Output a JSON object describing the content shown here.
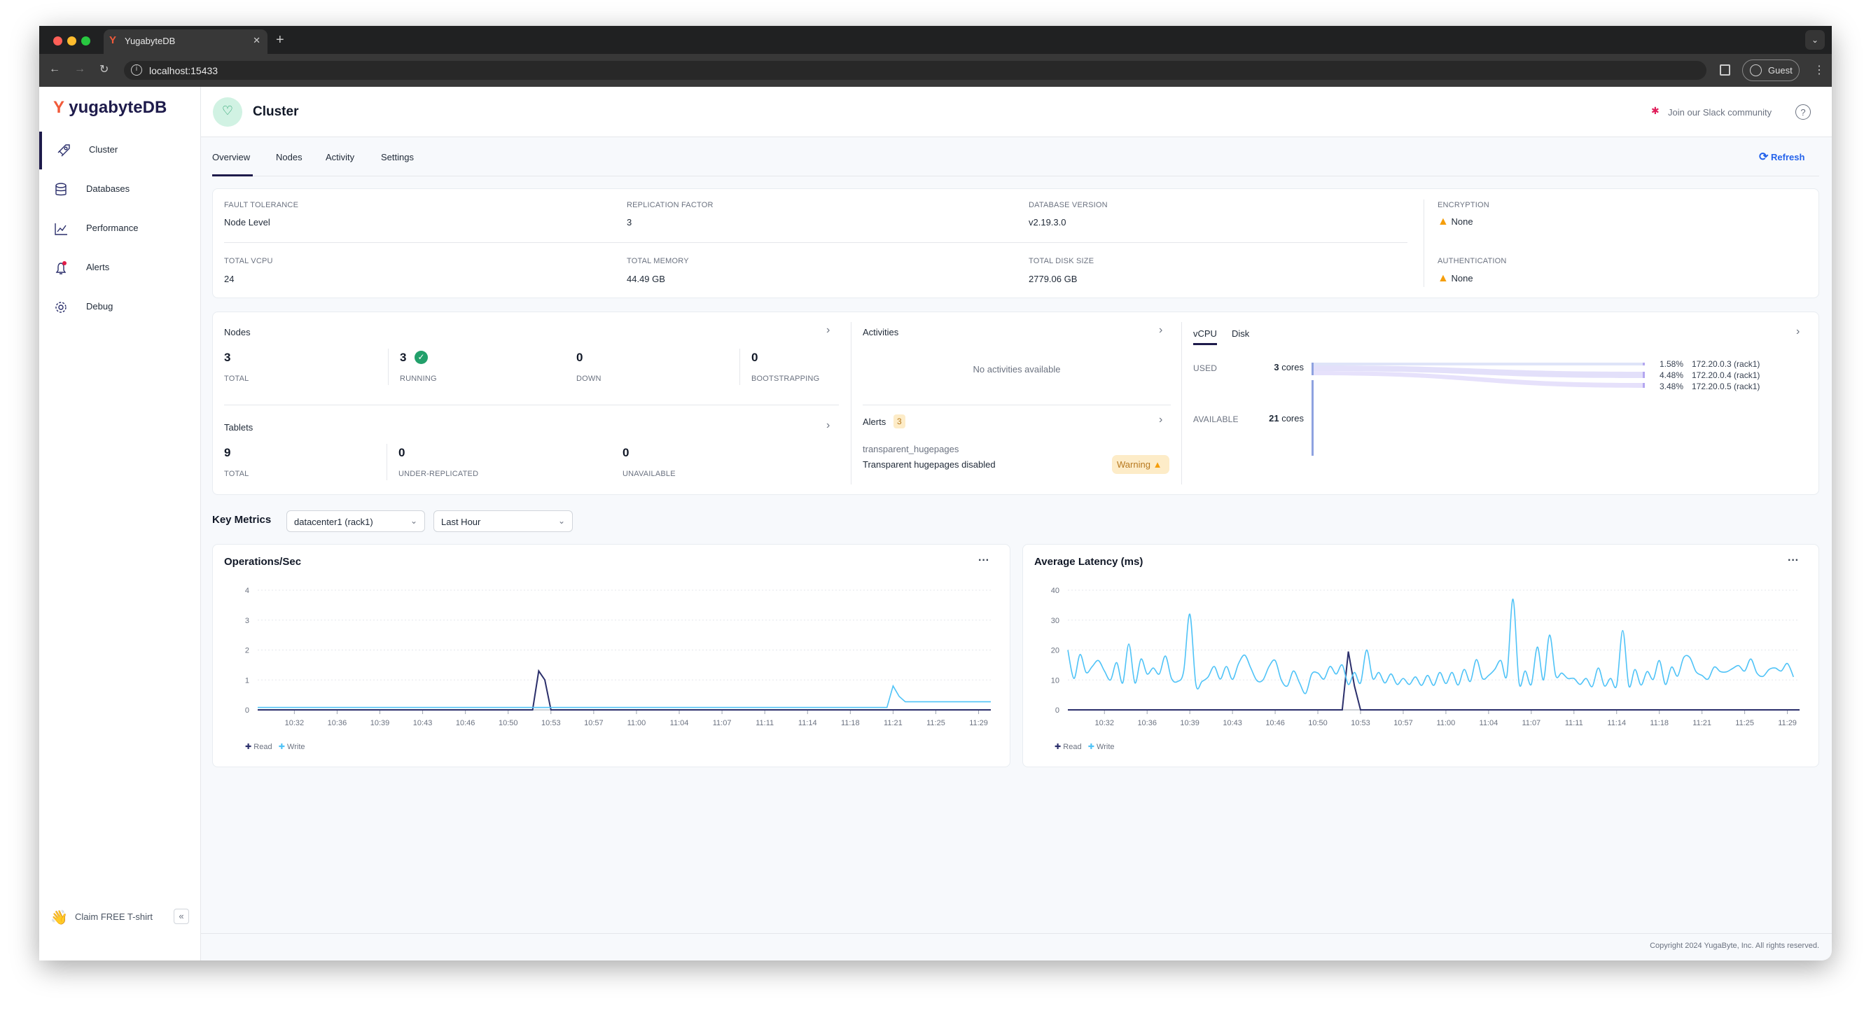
{
  "browser": {
    "tab_title": "YugabyteDB",
    "url": "localhost:15433",
    "profile": "Guest"
  },
  "sidebar": {
    "logo": "yugabyteDB",
    "items": [
      {
        "label": "Cluster",
        "icon": "rocket-icon"
      },
      {
        "label": "Databases",
        "icon": "database-icon"
      },
      {
        "label": "Performance",
        "icon": "chart-line-icon"
      },
      {
        "label": "Alerts",
        "icon": "bell-icon"
      },
      {
        "label": "Debug",
        "icon": "gear-icon"
      }
    ],
    "promo": "Claim FREE T-shirt"
  },
  "header": {
    "title": "Cluster",
    "slack": "Join our Slack community"
  },
  "tabs": [
    "Overview",
    "Nodes",
    "Activity",
    "Settings"
  ],
  "refresh": "Refresh",
  "info": {
    "fault_tolerance": {
      "label": "FAULT TOLERANCE",
      "value": "Node Level"
    },
    "replication_factor": {
      "label": "REPLICATION FACTOR",
      "value": "3"
    },
    "database_version": {
      "label": "DATABASE VERSION",
      "value": "v2.19.3.0"
    },
    "encryption": {
      "label": "ENCRYPTION",
      "value": "None"
    },
    "total_vcpu": {
      "label": "TOTAL VCPU",
      "value": "24"
    },
    "total_memory": {
      "label": "TOTAL MEMORY",
      "value": "44.49 GB"
    },
    "total_disk": {
      "label": "TOTAL DISK SIZE",
      "value": "2779.06 GB"
    },
    "authentication": {
      "label": "AUTHENTICATION",
      "value": "None"
    }
  },
  "nodes": {
    "title": "Nodes",
    "stats": [
      {
        "value": "3",
        "label": "TOTAL"
      },
      {
        "value": "3",
        "label": "RUNNING"
      },
      {
        "value": "0",
        "label": "DOWN"
      },
      {
        "value": "0",
        "label": "BOOTSTRAPPING"
      }
    ]
  },
  "tablets": {
    "title": "Tablets",
    "stats": [
      {
        "value": "9",
        "label": "TOTAL"
      },
      {
        "value": "0",
        "label": "UNDER-REPLICATED"
      },
      {
        "value": "0",
        "label": "UNAVAILABLE"
      }
    ]
  },
  "activities": {
    "title": "Activities",
    "empty": "No activities available"
  },
  "alerts": {
    "title": "Alerts",
    "count": "3",
    "name": "transparent_hugepages",
    "description": "Transparent hugepages disabled",
    "severity": "Warning"
  },
  "usage": {
    "tabs": [
      "vCPU",
      "Disk"
    ],
    "used_label": "USED",
    "used_value": "3",
    "available_label": "AVAILABLE",
    "available_value": "21",
    "unit": "cores",
    "nodes": [
      {
        "pct": "1.58%",
        "name": "172.20.0.3 (rack1)"
      },
      {
        "pct": "4.48%",
        "name": "172.20.0.4 (rack1)"
      },
      {
        "pct": "3.48%",
        "name": "172.20.0.5 (rack1)"
      }
    ]
  },
  "key_metrics": {
    "title": "Key Metrics",
    "region": "datacenter1 (rack1)",
    "range": "Last Hour"
  },
  "colors": {
    "read": "#2b2f6b",
    "write": "#4fc3f7",
    "accent": "#2563eb",
    "warning": "#f59e0b"
  },
  "chart_data": [
    {
      "type": "line",
      "title": "Operations/Sec",
      "ylim": [
        0,
        4
      ],
      "yticks": [
        0,
        1,
        2,
        3,
        4
      ],
      "xlim": [
        "10:29:00",
        "11:29:00"
      ],
      "xticks": [
        "10:32",
        "10:36",
        "10:39",
        "10:43",
        "10:46",
        "10:50",
        "10:53",
        "10:57",
        "11:00",
        "11:04",
        "11:07",
        "11:11",
        "11:14",
        "11:18",
        "11:21",
        "11:25",
        "11:29"
      ],
      "grid": true,
      "legend": "bottom-left",
      "series": [
        {
          "name": "Read",
          "x": [
            "10:29:00",
            "10:51:30",
            "10:52:00",
            "10:52:30",
            "10:53:00",
            "11:29:00"
          ],
          "values": [
            0,
            0,
            1.3,
            1.0,
            0,
            0
          ]
        },
        {
          "name": "Write",
          "x": [
            "10:29:00",
            "11:20:30",
            "11:21:00",
            "11:21:30",
            "11:22:00",
            "11:29:00"
          ],
          "values": [
            0.08,
            0.08,
            0.8,
            0.45,
            0.27,
            0.27
          ]
        }
      ]
    },
    {
      "type": "line",
      "title": "Average Latency (ms)",
      "ylim": [
        0,
        40
      ],
      "yticks": [
        0,
        10,
        20,
        30,
        40
      ],
      "xlim": [
        "10:29:00",
        "11:29:00"
      ],
      "xticks": [
        "10:32",
        "10:36",
        "10:39",
        "10:43",
        "10:46",
        "10:50",
        "10:53",
        "10:57",
        "11:00",
        "11:04",
        "11:07",
        "11:11",
        "11:14",
        "11:18",
        "11:21",
        "11:25",
        "11:29"
      ],
      "grid": true,
      "legend": "bottom-left",
      "series": [
        {
          "name": "Read",
          "x": [
            "10:29:00",
            "10:51:30",
            "10:52:00",
            "10:52:30",
            "10:53:00",
            "11:29:00"
          ],
          "values": [
            0,
            0,
            19.5,
            8,
            0,
            0
          ]
        },
        {
          "name": "Write",
          "x_start": "10:29:00",
          "x_interval": "30s",
          "values": [
            20,
            10.5,
            18.5,
            12.5,
            14.5,
            16.5,
            13,
            10,
            15.8,
            9,
            22,
            9,
            17,
            12,
            14,
            12,
            18,
            10.5,
            9.5,
            13,
            32,
            8.5,
            9.5,
            11,
            14.5,
            10.3,
            14.5,
            10.2,
            15.5,
            18.3,
            14,
            9.8,
            10,
            14.5,
            16.5,
            10,
            8,
            13,
            9,
            5.5,
            12,
            12.3,
            10.3,
            14.5,
            12,
            15,
            8.5,
            12.5,
            9,
            20,
            10.5,
            12.5,
            9,
            12,
            8.5,
            10.5,
            8.5,
            11,
            8.2,
            11.5,
            8.2,
            12.5,
            8.8,
            12.5,
            8.3,
            13.5,
            9.5,
            16.8,
            10.5,
            11.5,
            13.5,
            16.5,
            11.5,
            37,
            9,
            13,
            8.5,
            21,
            10,
            25,
            11.5,
            12.3,
            10.5,
            10.5,
            8.5,
            10.5,
            7.8,
            14,
            8,
            10.5,
            8.2,
            26.5,
            8,
            13.5,
            8.3,
            12.8,
            10.2,
            16.5,
            8.5,
            14.3,
            11.3,
            17.5,
            17.5,
            12.8,
            11.5,
            10.3,
            14.3,
            12.8,
            12.7,
            13.8,
            14.8,
            13,
            17,
            12.3,
            11.2,
            13.5,
            14,
            13,
            15.5,
            11
          ]
        }
      ]
    }
  ],
  "footer": {
    "copyright": "Copyright 2024 YugaByte, Inc. All rights reserved."
  }
}
